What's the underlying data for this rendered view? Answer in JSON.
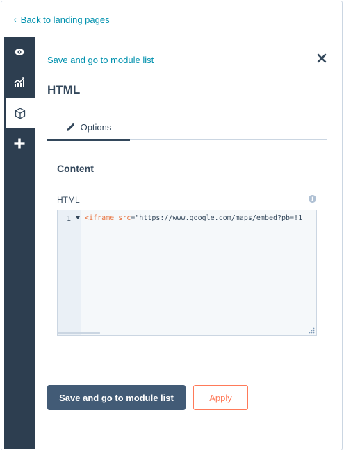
{
  "nav": {
    "back_chevron": "‹",
    "back_label": "Back to landing pages"
  },
  "rail": {
    "items": [
      {
        "icon": "eye-icon"
      },
      {
        "icon": "analytics-icon"
      },
      {
        "icon": "module-cube-icon",
        "active": true
      },
      {
        "icon": "plus-icon"
      }
    ]
  },
  "panel": {
    "save_link": "Save and go to module list",
    "title": "HTML",
    "tabs": [
      {
        "label": "Options",
        "icon": "pencil-icon"
      }
    ]
  },
  "content": {
    "section_title": "Content",
    "field_label": "HTML",
    "info_glyph": "i",
    "editor": {
      "line_number": "1",
      "code_tag": "<iframe",
      "code_attr": "src",
      "code_eq": "=",
      "code_value": "\"https://www.google.com/maps/embed?pb=!1"
    }
  },
  "actions": {
    "primary_label": "Save and go to module list",
    "secondary_label": "Apply"
  },
  "colors": {
    "link": "#0091ae",
    "rail": "#2d3e50",
    "primary": "#425b76",
    "accent": "#ff7a59",
    "text": "#33475b"
  }
}
